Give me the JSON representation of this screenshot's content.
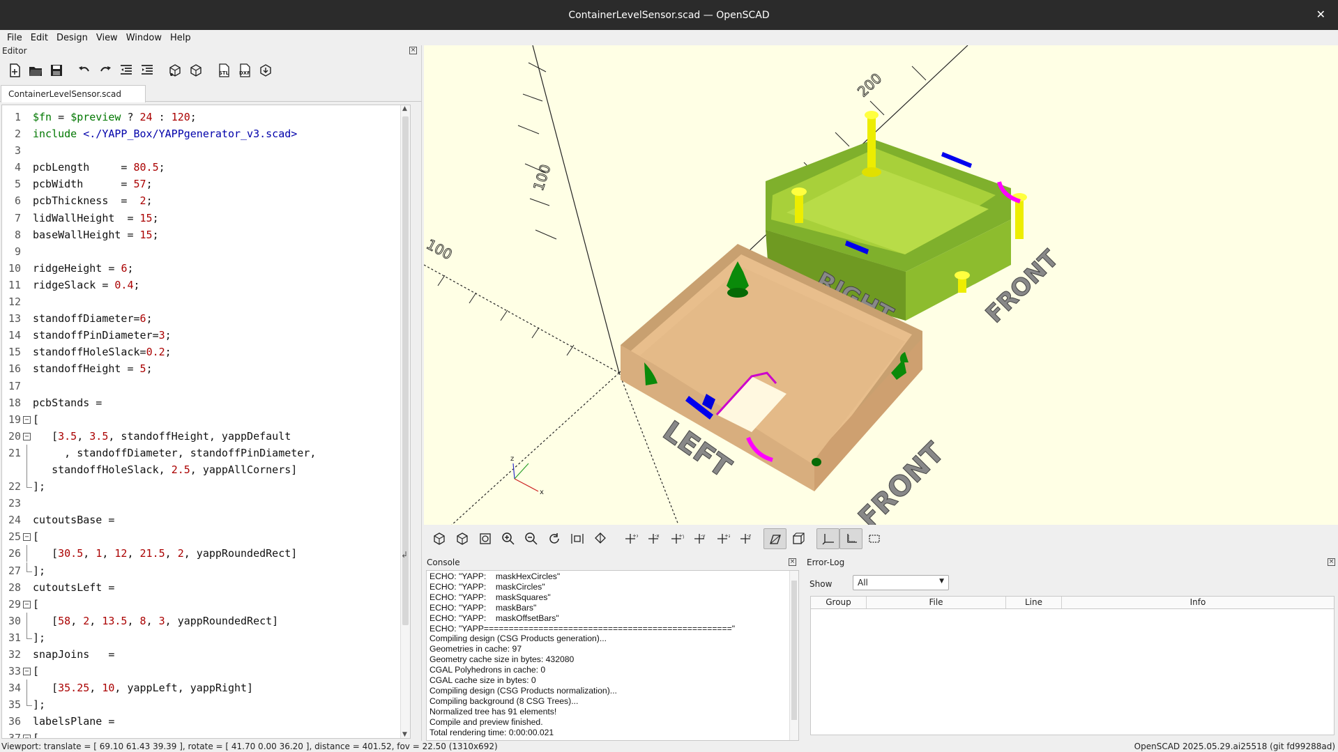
{
  "window": {
    "title": "ContainerLevelSensor.scad — OpenSCAD"
  },
  "menu": [
    "File",
    "Edit",
    "Design",
    "View",
    "Window",
    "Help"
  ],
  "editor": {
    "title": "Editor",
    "tab": "ContainerLevelSensor.scad",
    "lines": [
      {
        "n": "1",
        "segs": [
          [
            "kw",
            "$fn"
          ],
          [
            "pl",
            " = "
          ],
          [
            "kw",
            "$preview"
          ],
          [
            "pl",
            " ? "
          ],
          [
            "num",
            "24"
          ],
          [
            "pl",
            " : "
          ],
          [
            "num",
            "120"
          ],
          [
            "pl",
            ";"
          ]
        ]
      },
      {
        "n": "2",
        "segs": [
          [
            "kw",
            "include"
          ],
          [
            "pl",
            " "
          ],
          [
            "str",
            "<./YAPP_Box/YAPPgenerator_v3.scad>"
          ]
        ]
      },
      {
        "n": "3",
        "segs": []
      },
      {
        "n": "4",
        "segs": [
          [
            "pl",
            "pcbLength     = "
          ],
          [
            "num",
            "80.5"
          ],
          [
            "pl",
            ";"
          ]
        ]
      },
      {
        "n": "5",
        "segs": [
          [
            "pl",
            "pcbWidth      = "
          ],
          [
            "num",
            "57"
          ],
          [
            "pl",
            ";"
          ]
        ]
      },
      {
        "n": "6",
        "segs": [
          [
            "pl",
            "pcbThickness  =  "
          ],
          [
            "num",
            "2"
          ],
          [
            "pl",
            ";"
          ]
        ]
      },
      {
        "n": "7",
        "segs": [
          [
            "pl",
            "lidWallHeight  = "
          ],
          [
            "num",
            "15"
          ],
          [
            "pl",
            ";"
          ]
        ]
      },
      {
        "n": "8",
        "segs": [
          [
            "pl",
            "baseWallHeight = "
          ],
          [
            "num",
            "15"
          ],
          [
            "pl",
            ";"
          ]
        ]
      },
      {
        "n": "9",
        "segs": []
      },
      {
        "n": "10",
        "segs": [
          [
            "pl",
            "ridgeHeight = "
          ],
          [
            "num",
            "6"
          ],
          [
            "pl",
            ";"
          ]
        ]
      },
      {
        "n": "11",
        "segs": [
          [
            "pl",
            "ridgeSlack = "
          ],
          [
            "num",
            "0.4"
          ],
          [
            "pl",
            ";"
          ]
        ]
      },
      {
        "n": "12",
        "segs": []
      },
      {
        "n": "13",
        "segs": [
          [
            "pl",
            "standoffDiameter="
          ],
          [
            "num",
            "6"
          ],
          [
            "pl",
            ";"
          ]
        ]
      },
      {
        "n": "14",
        "segs": [
          [
            "pl",
            "standoffPinDiameter="
          ],
          [
            "num",
            "3"
          ],
          [
            "pl",
            ";"
          ]
        ]
      },
      {
        "n": "15",
        "segs": [
          [
            "pl",
            "standoffHoleSlack="
          ],
          [
            "num",
            "0.2"
          ],
          [
            "pl",
            ";"
          ]
        ]
      },
      {
        "n": "16",
        "segs": [
          [
            "pl",
            "standoffHeight = "
          ],
          [
            "num",
            "5"
          ],
          [
            "pl",
            ";"
          ]
        ]
      },
      {
        "n": "17",
        "segs": []
      },
      {
        "n": "18",
        "segs": [
          [
            "pl",
            "pcbStands ="
          ]
        ]
      },
      {
        "n": "19",
        "fold": "box",
        "segs": [
          [
            "pl",
            "["
          ]
        ]
      },
      {
        "n": "20",
        "fold": "box",
        "segs": [
          [
            "pl",
            "   ["
          ],
          [
            "num",
            "3.5"
          ],
          [
            "pl",
            ", "
          ],
          [
            "num",
            "3.5"
          ],
          [
            "pl",
            ", standoffHeight, yappDefault"
          ]
        ]
      },
      {
        "n": "21",
        "fold": "line",
        "segs": [
          [
            "pl",
            "     , standoffDiameter, standoffPinDiameter,"
          ]
        ]
      },
      {
        "n": "",
        "fold": "line",
        "segs": [
          [
            "pl",
            "   standoffHoleSlack, "
          ],
          [
            "num",
            "2.5"
          ],
          [
            "pl",
            ", yappAllCorners]"
          ]
        ]
      },
      {
        "n": "22",
        "fold": "end",
        "segs": [
          [
            "pl",
            "];"
          ]
        ]
      },
      {
        "n": "23",
        "segs": []
      },
      {
        "n": "24",
        "segs": [
          [
            "pl",
            "cutoutsBase ="
          ]
        ]
      },
      {
        "n": "25",
        "fold": "box",
        "segs": [
          [
            "pl",
            "["
          ]
        ]
      },
      {
        "n": "26",
        "fold": "line",
        "segs": [
          [
            "pl",
            "   ["
          ],
          [
            "num",
            "30.5"
          ],
          [
            "pl",
            ", "
          ],
          [
            "num",
            "1"
          ],
          [
            "pl",
            ", "
          ],
          [
            "num",
            "12"
          ],
          [
            "pl",
            ", "
          ],
          [
            "num",
            "21.5"
          ],
          [
            "pl",
            ", "
          ],
          [
            "num",
            "2"
          ],
          [
            "pl",
            ", yappRoundedRect]"
          ]
        ]
      },
      {
        "n": "27",
        "fold": "end",
        "segs": [
          [
            "pl",
            "];"
          ]
        ]
      },
      {
        "n": "28",
        "segs": [
          [
            "pl",
            "cutoutsLeft ="
          ]
        ]
      },
      {
        "n": "29",
        "fold": "box",
        "segs": [
          [
            "pl",
            "["
          ]
        ]
      },
      {
        "n": "30",
        "fold": "line",
        "segs": [
          [
            "pl",
            "   ["
          ],
          [
            "num",
            "58"
          ],
          [
            "pl",
            ", "
          ],
          [
            "num",
            "2"
          ],
          [
            "pl",
            ", "
          ],
          [
            "num",
            "13.5"
          ],
          [
            "pl",
            ", "
          ],
          [
            "num",
            "8"
          ],
          [
            "pl",
            ", "
          ],
          [
            "num",
            "3"
          ],
          [
            "pl",
            ", yappRoundedRect]"
          ]
        ]
      },
      {
        "n": "31",
        "fold": "end",
        "segs": [
          [
            "pl",
            "];"
          ]
        ]
      },
      {
        "n": "32",
        "segs": [
          [
            "pl",
            "snapJoins   ="
          ]
        ]
      },
      {
        "n": "33",
        "fold": "box",
        "segs": [
          [
            "pl",
            "["
          ]
        ]
      },
      {
        "n": "34",
        "fold": "line",
        "segs": [
          [
            "pl",
            "   ["
          ],
          [
            "num",
            "35.25"
          ],
          [
            "pl",
            ", "
          ],
          [
            "num",
            "10"
          ],
          [
            "pl",
            ", yappLeft, yappRight]"
          ]
        ]
      },
      {
        "n": "35",
        "fold": "end",
        "segs": [
          [
            "pl",
            "];"
          ]
        ]
      },
      {
        "n": "36",
        "segs": [
          [
            "pl",
            "labelsPlane ="
          ]
        ]
      },
      {
        "n": "37",
        "fold": "box",
        "segs": [
          [
            "pl",
            "["
          ]
        ]
      }
    ]
  },
  "viewport": {
    "axis_labels": [
      "100",
      "200",
      "100",
      "100",
      "100"
    ],
    "labels": {
      "right": "RIGHT",
      "front_lid": "FRONT",
      "left": "LEFT",
      "front_base": "FRONT",
      "axis_z": "z",
      "axis_x": "x"
    },
    "colors": {
      "background": "#ffffe5",
      "lid": "#9acd32",
      "base": "#e2b98b",
      "standoff_lid": "#ffff00",
      "standoff_base": "#008000",
      "cutout_blue": "#0000ff",
      "cutout_magenta": "#ff00ff"
    }
  },
  "console": {
    "title": "Console",
    "lines": [
      "ECHO: \"YAPP:    maskHexCircles\"",
      "ECHO: \"YAPP:    maskCircles\"",
      "ECHO: \"YAPP:    maskSquares\"",
      "ECHO: \"YAPP:    maskBars\"",
      "ECHO: \"YAPP:    maskOffsetBars\"",
      "ECHO: \"YAPP==================================================\"",
      "Compiling design (CSG Products generation)...",
      "Geometries in cache: 97",
      "Geometry cache size in bytes: 432080",
      "CGAL Polyhedrons in cache: 0",
      "CGAL cache size in bytes: 0",
      "Compiling design (CSG Products normalization)...",
      "Compiling background (8 CSG Trees)...",
      "Normalized tree has 91 elements!",
      "Compile and preview finished.",
      "Total rendering time: 0:00:00.021"
    ]
  },
  "errorlog": {
    "title": "Error-Log",
    "show_label": "Show",
    "show_value": "All",
    "columns": [
      "Group",
      "File",
      "Line",
      "Info"
    ]
  },
  "status": {
    "left": "Viewport: translate = [ 69.10 61.43 39.39 ], rotate = [ 41.70 0.00 36.20 ], distance = 401.52, fov = 22.50 (1310x692)",
    "right": "OpenSCAD 2025.05.29.ai25518 (git fd99288ad)"
  }
}
